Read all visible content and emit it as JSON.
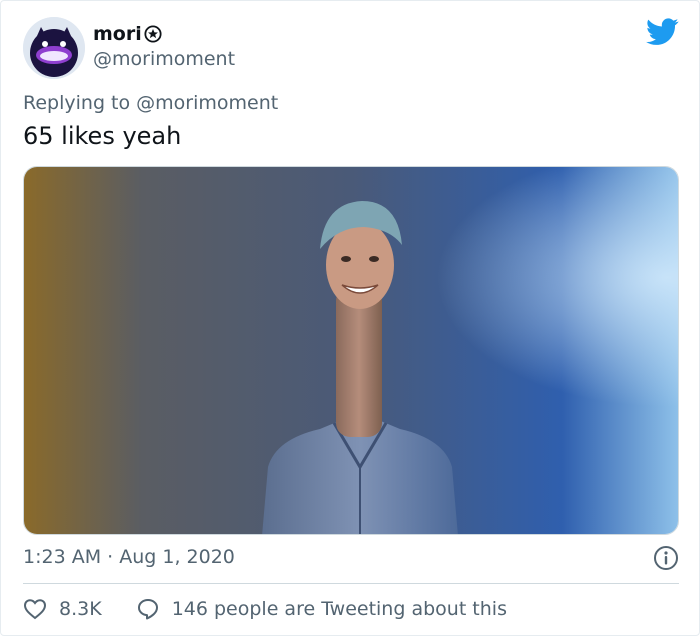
{
  "author": {
    "display_name": "mori",
    "handle": "@morimoment"
  },
  "reply": {
    "prefix": "Replying to ",
    "mention": "@morimoment"
  },
  "tweet": {
    "text": "65 likes yeah"
  },
  "meta": {
    "timestamp": "1:23 AM · Aug 1, 2020"
  },
  "stats": {
    "likes": "8.3K",
    "retweets_text": "146 people are Tweeting about this"
  },
  "colors": {
    "brand": "#1d9bf0",
    "secondary_text": "#536471"
  },
  "icons": {
    "badge": "star-badge-icon",
    "logo": "twitter-bird-icon",
    "info": "info-icon",
    "like": "heart-icon",
    "reply": "comment-bubble-icon"
  }
}
